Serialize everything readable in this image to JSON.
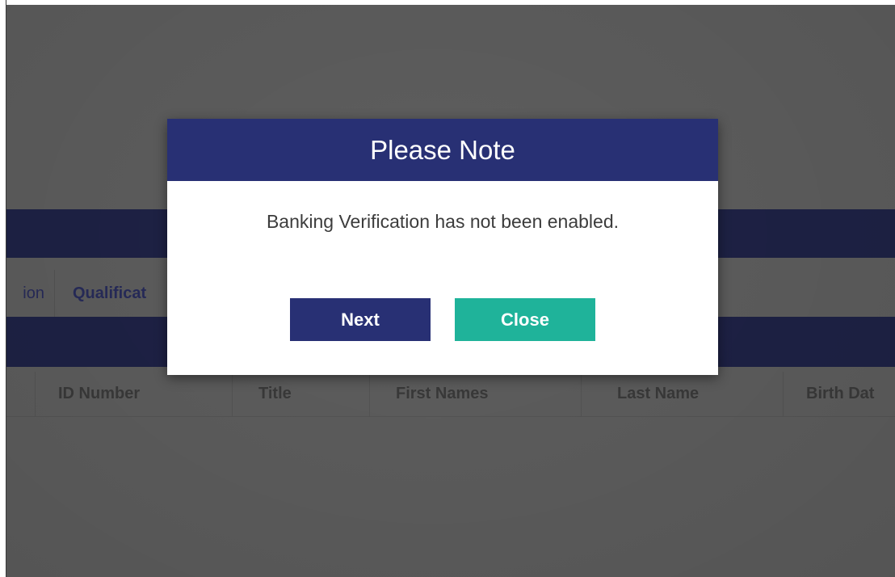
{
  "background": {
    "tabs": [
      "ion",
      "Qualificat"
    ],
    "table_headers": [
      "",
      "ID Number",
      "Title",
      "First Names",
      "Last Name",
      "Birth Dat"
    ]
  },
  "modal": {
    "title": "Please Note",
    "message": "Banking Verification has not been enabled.",
    "next_label": "Next",
    "close_label": "Close"
  },
  "colors": {
    "header_band": "#1e2246",
    "modal_header": "#283074",
    "next_button": "#283074",
    "close_button": "#1fb39a",
    "backdrop": "#5e5e5e"
  }
}
